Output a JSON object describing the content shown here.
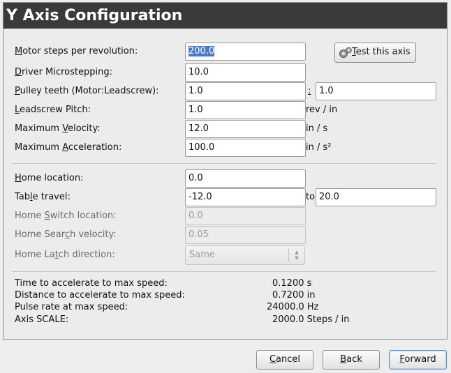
{
  "window": {
    "title": "Y Axis Configuration"
  },
  "motor_section": {
    "steps_per_rev": {
      "label_mn": "M",
      "label_rest": "otor steps per revolution:",
      "value": "200.0"
    },
    "microstepping": {
      "label_mn": "D",
      "label_rest": "river Microstepping:",
      "value": "10.0"
    },
    "pulley_teeth": {
      "label_mn": "P",
      "label_rest": "ulley teeth (Motor:Leadscrew):",
      "motor_value": "1.0",
      "sep": ":",
      "leadscrew_value": "1.0"
    },
    "leadscrew_pitch": {
      "label_mn": "L",
      "label_rest": "eadscrew Pitch:",
      "value": "1.0",
      "unit": "rev / in"
    },
    "max_velocity": {
      "label_pre": "Maximum ",
      "label_mn": "V",
      "label_rest": "elocity:",
      "value": "12.0",
      "unit": "in / s"
    },
    "max_accel": {
      "label_pre": "Maximum ",
      "label_mn": "A",
      "label_rest": "cceleration:",
      "value": "100.0",
      "unit": "in / s²"
    }
  },
  "test_button": {
    "label_mn": "T",
    "label_rest": "est this axis",
    "icon": "gears-icon"
  },
  "home_section": {
    "home_location": {
      "label_mn": "H",
      "label_rest": "ome location:",
      "value": "0.0"
    },
    "table_travel": {
      "label_pre": "Tab",
      "label_mn": "l",
      "label_rest": "e travel:",
      "min_value": "-12.0",
      "to": "to",
      "max_value": "20.0"
    },
    "home_switch_location": {
      "label_pre": "Home ",
      "label_mn": "S",
      "label_rest": "witch location:",
      "value": "0.0"
    },
    "home_search_velocity": {
      "label_pre": "Home Sear",
      "label_mn": "c",
      "label_rest": "h velocity:",
      "value": "0.05"
    },
    "home_latch_direction": {
      "label_pre": "Home La",
      "label_mn": "t",
      "label_rest": "ch direction:",
      "value": "Same"
    }
  },
  "info": [
    {
      "label": "Time to accelerate to max speed:",
      "value": "0.1200 s"
    },
    {
      "label": "Distance to accelerate to max speed:",
      "value": "0.7200 in"
    },
    {
      "label": "Pulse rate at max speed:",
      "value": "24000.0 Hz"
    },
    {
      "label": "Axis SCALE:",
      "value": "2000.0 Steps / in"
    }
  ],
  "footer": {
    "cancel": {
      "label_mn": "C",
      "label_rest": "ancel"
    },
    "back": {
      "label_mn": "B",
      "label_rest": "ack"
    },
    "forward": {
      "label_mn": "F",
      "label_rest": "orward"
    }
  }
}
